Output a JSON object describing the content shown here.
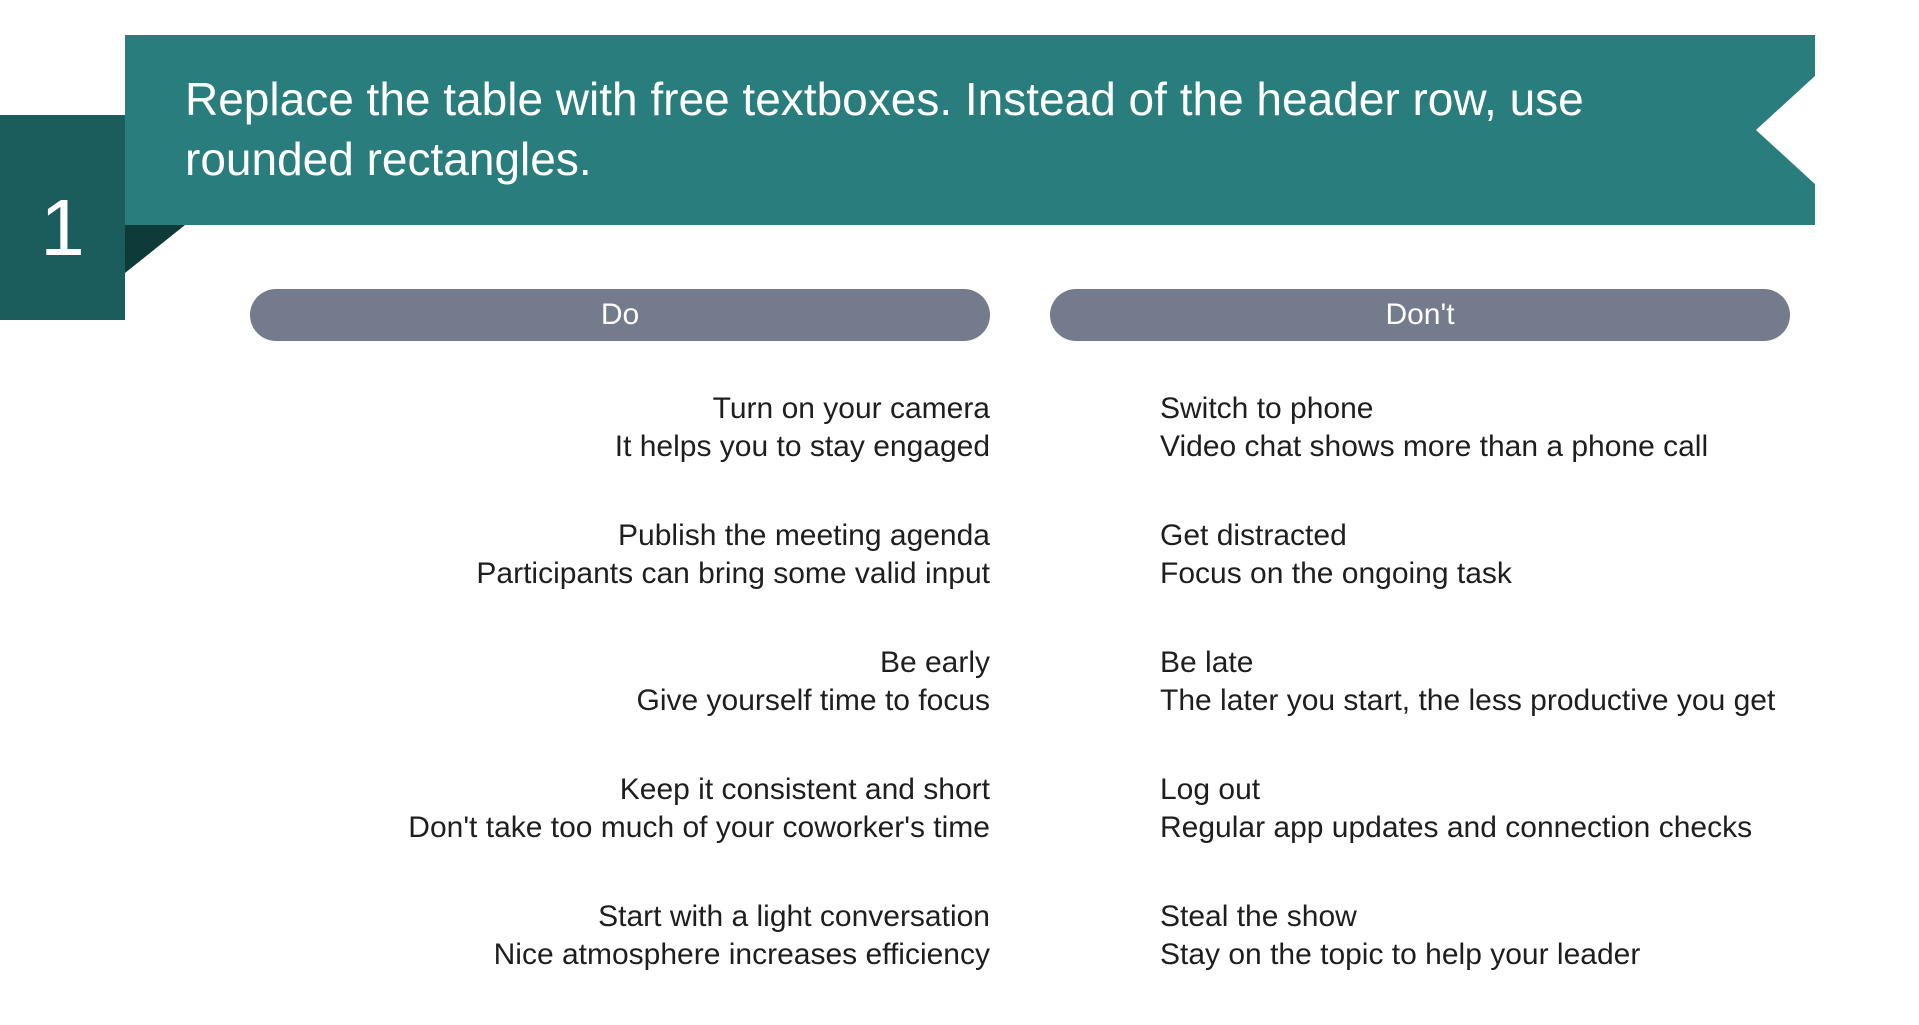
{
  "slide_number": "1",
  "title": "Replace the table with free textboxes. Instead of the header row, use rounded rectangles.",
  "colors": {
    "ribbon": "#2a7d7d",
    "ribbon_dark": "#1b5c5c",
    "pill": "#737b8c"
  },
  "columns": {
    "do": {
      "header": "Do",
      "items": [
        {
          "title": "Turn on your camera",
          "sub": "It helps you to stay engaged"
        },
        {
          "title": "Publish the meeting agenda",
          "sub": "Participants can bring some valid input"
        },
        {
          "title": "Be early",
          "sub": "Give yourself time to focus"
        },
        {
          "title": "Keep it consistent and short",
          "sub": "Don't take too much of your coworker's time"
        },
        {
          "title": "Start with a light conversation",
          "sub": "Nice atmosphere increases efficiency"
        }
      ]
    },
    "dont": {
      "header": "Don't",
      "items": [
        {
          "title": "Switch to phone",
          "sub": "Video chat shows more than a phone call"
        },
        {
          "title": "Get distracted",
          "sub": "Focus on the ongoing task"
        },
        {
          "title": "Be late",
          "sub": "The later you start, the less productive you get"
        },
        {
          "title": "Log out",
          "sub": "Regular app updates and connection checks"
        },
        {
          "title": "Steal the show",
          "sub": "Stay on the topic to help your leader"
        }
      ]
    }
  }
}
